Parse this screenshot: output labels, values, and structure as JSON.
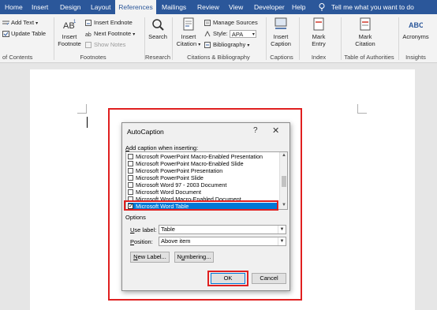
{
  "tabs": [
    {
      "label": "Home",
      "active": false
    },
    {
      "label": "Insert",
      "active": false
    },
    {
      "label": "Design",
      "active": false
    },
    {
      "label": "Layout",
      "active": false
    },
    {
      "label": "References",
      "active": true
    },
    {
      "label": "Mailings",
      "active": false
    },
    {
      "label": "Review",
      "active": false
    },
    {
      "label": "View",
      "active": false
    },
    {
      "label": "Developer",
      "active": false
    },
    {
      "label": "Help",
      "active": false
    }
  ],
  "tell_me": "Tell me what you want to do",
  "ribbon": {
    "toc": {
      "add_text": "Add Text",
      "update_table": "Update Table",
      "group": "of Contents"
    },
    "footnotes": {
      "insert_footnote_line1": "Insert",
      "insert_footnote_line2": "Footnote",
      "insert_endnote": "Insert Endnote",
      "next_footnote": "Next Footnote",
      "show_notes": "Show Notes",
      "group": "Footnotes"
    },
    "research": {
      "search": "Search",
      "group": "Research"
    },
    "citations": {
      "insert_citation_line1": "Insert",
      "insert_citation_line2": "Citation",
      "manage_sources": "Manage Sources",
      "style_label": "Style:",
      "style_value": "APA",
      "bibliography": "Bibliography",
      "group": "Citations & Bibliography"
    },
    "captions": {
      "insert_caption_line1": "Insert",
      "insert_caption_line2": "Caption",
      "group": "Captions"
    },
    "index": {
      "mark_entry_line1": "Mark",
      "mark_entry_line2": "Entry",
      "group": "Index"
    },
    "toa": {
      "mark_citation_line1": "Mark",
      "mark_citation_line2": "Citation",
      "group": "Table of Authorities"
    },
    "insights": {
      "acronyms": "Acronyms",
      "group": "Insights"
    }
  },
  "dialog": {
    "title": "AutoCaption",
    "help": "?",
    "close": "✕",
    "add_caption_label": "Add caption when inserting:",
    "items": [
      {
        "label": "Microsoft PowerPoint Macro-Enabled Presentation",
        "checked": false
      },
      {
        "label": "Microsoft PowerPoint Macro-Enabled Slide",
        "checked": false
      },
      {
        "label": "Microsoft PowerPoint Presentation",
        "checked": false
      },
      {
        "label": "Microsoft PowerPoint Slide",
        "checked": false
      },
      {
        "label": "Microsoft Word 97 - 2003 Document",
        "checked": false
      },
      {
        "label": "Microsoft Word Document",
        "checked": false
      },
      {
        "label": "Microsoft Word Macro-Enabled Document",
        "checked": false
      },
      {
        "label": "Microsoft Word Table",
        "checked": true,
        "selected": true
      }
    ],
    "options_label": "Options",
    "use_label": "Use label:",
    "use_label_value": "Table",
    "position": "Position:",
    "position_value": "Above item",
    "new_label_button": "New Label...",
    "numbering_button": "Numbering...",
    "ok": "OK",
    "cancel": "Cancel"
  },
  "colors": {
    "ribbon_blue": "#2b579a",
    "highlight": "#e02020",
    "selection": "#0078d7"
  }
}
